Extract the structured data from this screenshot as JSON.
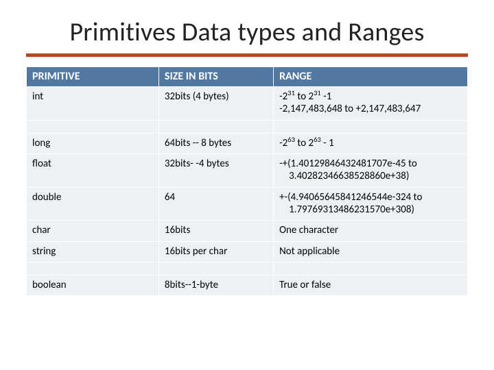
{
  "title": "Primitives Data types and Ranges",
  "headers": {
    "primitive": "PRIMITIVE",
    "size": "SIZE IN BITS",
    "range": "RANGE"
  },
  "rows": {
    "int": {
      "name": "int",
      "size": "32bits (4 bytes)",
      "range_pre": "-2",
      "range_exp1": "31",
      "range_mid": " to 2",
      "range_exp2": "31",
      "range_post": " -1",
      "range_line2": "-2,147,483,648  to +2,147,483,647"
    },
    "long": {
      "name": "long",
      "size": "64bits  -- 8 bytes",
      "range_pre": "-2",
      "range_exp1": "63",
      "range_mid": " to 2",
      "range_exp2": "63",
      "range_post": " -  1"
    },
    "float": {
      "name": "float",
      "size": "32bits- -4 bytes",
      "range_line1": "-+(1.40129846432481707e-45 to",
      "range_line2": "3.40282346638528860e+38)"
    },
    "double": {
      "name": "double",
      "size": "64",
      "range_line1": "+-(4.94065645841246544e-324 to",
      "range_line2": "1.79769313486231570e+308)"
    },
    "char": {
      "name": "char",
      "size": "16bits",
      "range": "One character"
    },
    "string": {
      "name": "string",
      "size": "16bits per char",
      "range": " Not applicable"
    },
    "boolean": {
      "name": "boolean",
      "size": "8bits--1-byte",
      "range": "True or false"
    }
  }
}
